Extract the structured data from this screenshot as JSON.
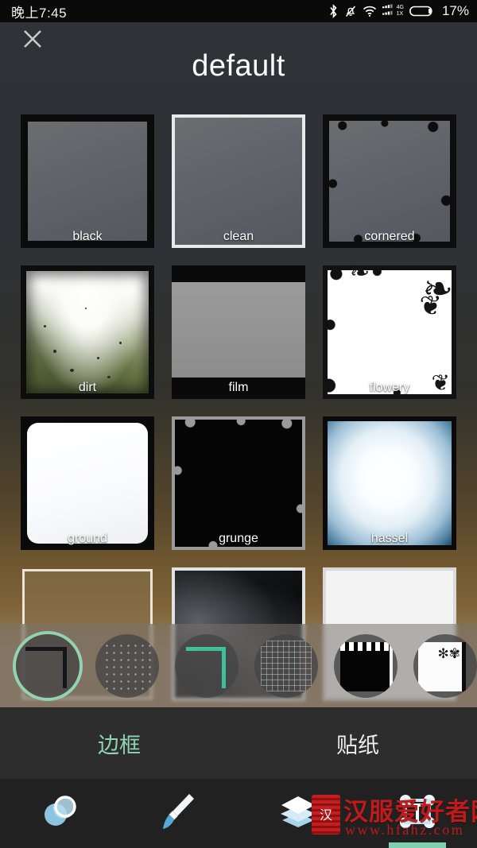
{
  "status_bar": {
    "time": "晚上7:45",
    "battery_percent": "17%",
    "network_primary": "4G",
    "network_secondary": "1X",
    "icons": [
      "bluetooth-icon",
      "mute-bell-icon",
      "wifi-icon",
      "signal-icon",
      "battery-icon"
    ]
  },
  "header": {
    "title": "default",
    "close_label": "×"
  },
  "grid": {
    "rows": [
      [
        {
          "label": "black",
          "style": "t-black"
        },
        {
          "label": "clean",
          "style": "t-clean",
          "selected": true
        },
        {
          "label": "cornered",
          "style": "t-cornered"
        }
      ],
      [
        {
          "label": "dirt",
          "style": "t-dirt"
        },
        {
          "label": "film",
          "style": "t-film"
        },
        {
          "label": "flowery",
          "style": "t-flowery"
        }
      ],
      [
        {
          "label": "ground",
          "style": "t-ground"
        },
        {
          "label": "grunge",
          "style": "t-grunge"
        },
        {
          "label": "hassel",
          "style": "t-hassel"
        }
      ],
      [
        {
          "label": "",
          "style": "t-r4a"
        },
        {
          "label": "",
          "style": "t-r4b"
        },
        {
          "label": "",
          "style": "t-r4c"
        }
      ]
    ]
  },
  "preset_strip": {
    "items": [
      {
        "name": "border-plain-preset",
        "icon": "corner-bracket-dark-icon",
        "selected": true
      },
      {
        "name": "border-dots-preset",
        "icon": "dot-texture-icon",
        "selected": false
      },
      {
        "name": "border-teal-preset",
        "icon": "corner-bracket-teal-icon",
        "selected": false
      },
      {
        "name": "border-grid-preset",
        "icon": "grid-texture-icon",
        "selected": false
      },
      {
        "name": "border-film-preset",
        "icon": "film-strip-icon",
        "selected": false
      },
      {
        "name": "border-flower-preset",
        "icon": "flower-frame-icon",
        "selected": false
      }
    ]
  },
  "tabs": [
    {
      "label": "边框",
      "active": true
    },
    {
      "label": "贴纸",
      "active": false
    }
  ],
  "bottom_nav": [
    {
      "label": "",
      "icon": "lens-circles-icon",
      "active": false
    },
    {
      "label": "",
      "icon": "brush-icon",
      "active": false
    },
    {
      "label": "",
      "icon": "layers-icon",
      "active": false
    },
    {
      "label": "",
      "icon": "text-tool-icon",
      "active": true
    }
  ],
  "watermark": {
    "site_name": "汉服爱好者网",
    "url": "www.hfahz.com"
  },
  "colors": {
    "accent_teal": "#8fd2b4",
    "preset_ring": "#93d3b2",
    "tab_bar_bg": "#2d2d2d",
    "nav_bar_bg": "#212121",
    "status_bar_bg": "#0a0a0a",
    "watermark_red": "#c01a1c"
  }
}
